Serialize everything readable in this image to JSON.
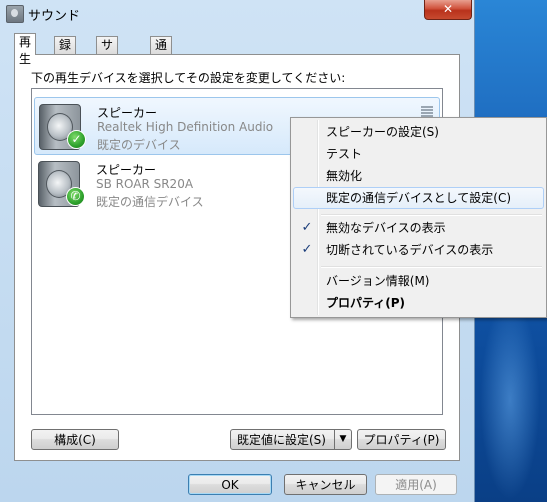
{
  "window": {
    "title": "サウンド",
    "close_glyph": "✕"
  },
  "tabs": [
    {
      "label": "再生",
      "active": true
    },
    {
      "label": "録音",
      "active": false
    },
    {
      "label": "サウンド",
      "active": false
    },
    {
      "label": "通信",
      "active": false
    }
  ],
  "playback": {
    "instruction": "下の再生デバイスを選択してその設定を変更してください:",
    "devices": [
      {
        "name": "スピーカー",
        "hardware": "Realtek High Definition Audio",
        "status": "既定のデバイス",
        "badge_icon": "check-icon",
        "badge_glyph": "✓",
        "selected": true
      },
      {
        "name": "スピーカー",
        "hardware": "SB ROAR SR20A",
        "status": "既定の通信デバイス",
        "badge_icon": "phone-icon",
        "badge_glyph": "✆",
        "selected": false
      }
    ],
    "buttons": {
      "configure": "構成(C)",
      "set_default": "既定値に設定(S)",
      "set_default_arrow": "▼",
      "properties": "プロパティ(P)"
    }
  },
  "dialog_buttons": {
    "ok": "OK",
    "cancel": "キャンセル",
    "apply": "適用(A)"
  },
  "context_menu": {
    "items": [
      {
        "label": "スピーカーの設定(S)",
        "checked": false,
        "bold": false,
        "hover": false
      },
      {
        "label": "テスト",
        "checked": false,
        "bold": false,
        "hover": false
      },
      {
        "label": "無効化",
        "checked": false,
        "bold": false,
        "hover": false
      },
      {
        "label": "既定の通信デバイスとして設定(C)",
        "checked": false,
        "bold": false,
        "hover": true
      },
      {
        "label": "無効なデバイスの表示",
        "checked": true,
        "bold": false,
        "hover": false
      },
      {
        "label": "切断されているデバイスの表示",
        "checked": true,
        "bold": false,
        "hover": false
      },
      {
        "label": "バージョン情報(M)",
        "checked": false,
        "bold": false,
        "hover": false
      },
      {
        "label": "プロパティ(P)",
        "checked": false,
        "bold": true,
        "hover": false
      }
    ],
    "check_glyph": "✓"
  },
  "colors": {
    "selection_border": "#9cc6ec",
    "menu_hover_border": "#aecff7",
    "badge_green": "#2ea12c",
    "close_red": "#c74a2f"
  }
}
